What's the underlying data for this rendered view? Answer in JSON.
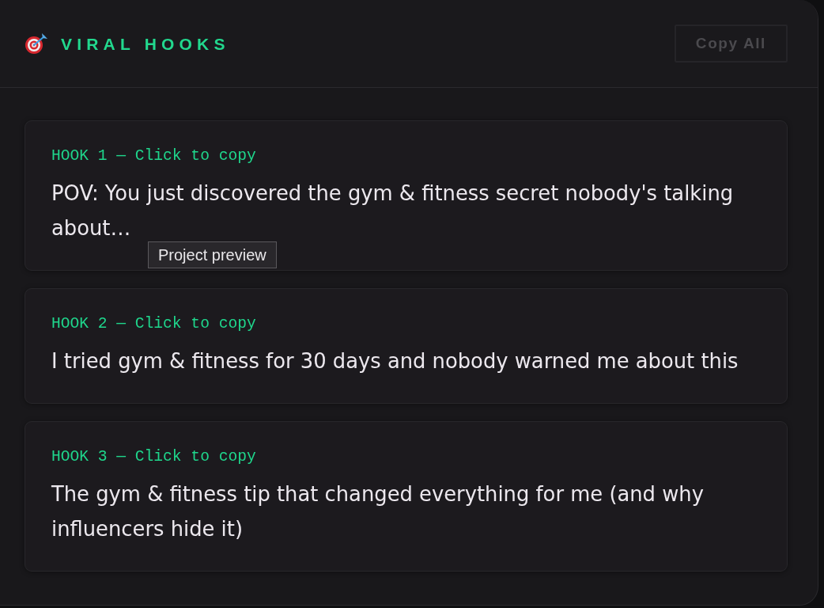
{
  "header": {
    "title": "VIRAL HOOKS",
    "copy_button": "Copy All"
  },
  "hooks": [
    {
      "label": "HOOK 1 — Click to copy",
      "text": "POV: You just discovered the gym & fitness secret nobody's talking about…",
      "tooltip": "Project preview"
    },
    {
      "label": "HOOK 2 — Click to copy",
      "text": "I tried gym & fitness for 30 days and nobody warned me about this"
    },
    {
      "label": "HOOK 3 — Click to copy",
      "text": "The gym & fitness tip that changed everything for me (and why influencers hide it)"
    }
  ]
}
